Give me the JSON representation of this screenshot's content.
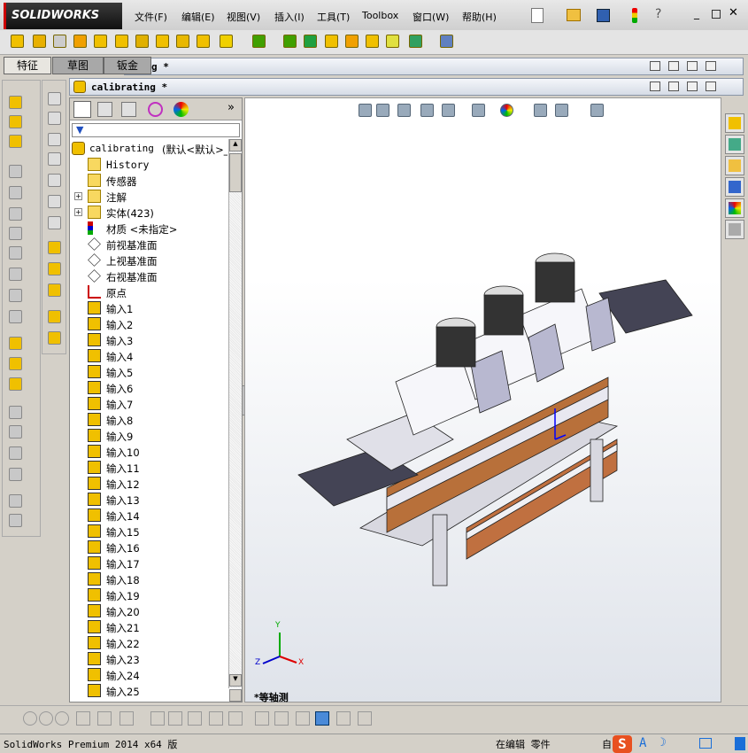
{
  "app": {
    "logo": "SOLIDWORKS"
  },
  "menu": [
    "文件(F)",
    "编辑(E)",
    "视图(V)",
    "插入(I)",
    "工具(T)",
    "Toolbox",
    "窗口(W)",
    "帮助(H)"
  ],
  "tabs": [
    "特征",
    "草图",
    "钣金"
  ],
  "back_doc": {
    "title": "g *"
  },
  "doc": {
    "title": "calibrating *"
  },
  "tree": {
    "root": "calibrating",
    "root_config": "(默认<默认>_",
    "items": [
      {
        "label": "History",
        "icon": "history-folder-icon"
      },
      {
        "label": "传感器",
        "icon": "sensor-folder-icon"
      },
      {
        "label": "注解",
        "icon": "annotation-folder-icon",
        "expand": true
      },
      {
        "label": "实体(423)",
        "icon": "solid-bodies-folder-icon",
        "expand": true
      },
      {
        "label": "材质 <未指定>",
        "icon": "material-icon"
      },
      {
        "label": "前视基准面",
        "icon": "plane-icon"
      },
      {
        "label": "上视基准面",
        "icon": "plane-icon"
      },
      {
        "label": "右视基准面",
        "icon": "plane-icon"
      },
      {
        "label": "原点",
        "icon": "origin-icon"
      },
      {
        "label": "输入1",
        "icon": "imported-body-icon"
      },
      {
        "label": "输入2",
        "icon": "imported-body-icon"
      },
      {
        "label": "输入3",
        "icon": "imported-body-icon"
      },
      {
        "label": "输入4",
        "icon": "imported-body-icon"
      },
      {
        "label": "输入5",
        "icon": "imported-body-icon"
      },
      {
        "label": "输入6",
        "icon": "imported-body-icon"
      },
      {
        "label": "输入7",
        "icon": "imported-body-icon"
      },
      {
        "label": "输入8",
        "icon": "imported-body-icon"
      },
      {
        "label": "输入9",
        "icon": "imported-body-icon"
      },
      {
        "label": "输入10",
        "icon": "imported-body-icon"
      },
      {
        "label": "输入11",
        "icon": "imported-body-icon"
      },
      {
        "label": "输入12",
        "icon": "imported-body-icon"
      },
      {
        "label": "输入13",
        "icon": "imported-body-icon"
      },
      {
        "label": "输入14",
        "icon": "imported-body-icon"
      },
      {
        "label": "输入15",
        "icon": "imported-body-icon"
      },
      {
        "label": "输入16",
        "icon": "imported-body-icon"
      },
      {
        "label": "输入17",
        "icon": "imported-body-icon"
      },
      {
        "label": "输入18",
        "icon": "imported-body-icon"
      },
      {
        "label": "输入19",
        "icon": "imported-body-icon"
      },
      {
        "label": "输入20",
        "icon": "imported-body-icon"
      },
      {
        "label": "输入21",
        "icon": "imported-body-icon"
      },
      {
        "label": "输入22",
        "icon": "imported-body-icon"
      },
      {
        "label": "输入23",
        "icon": "imported-body-icon"
      },
      {
        "label": "输入24",
        "icon": "imported-body-icon"
      },
      {
        "label": "输入25",
        "icon": "imported-body-icon"
      }
    ]
  },
  "view": {
    "orientation": "*等轴测",
    "triad": {
      "x": "X",
      "y": "Y",
      "z": "Z"
    }
  },
  "status": {
    "product": "SolidWorks Premium 2014 x64 版",
    "mode": "在编辑 零件",
    "custom": "自"
  },
  "colors": {
    "accent": "#f0c000",
    "viewport_top": "#ffffff",
    "viewport_bottom": "#dfe3ea"
  }
}
